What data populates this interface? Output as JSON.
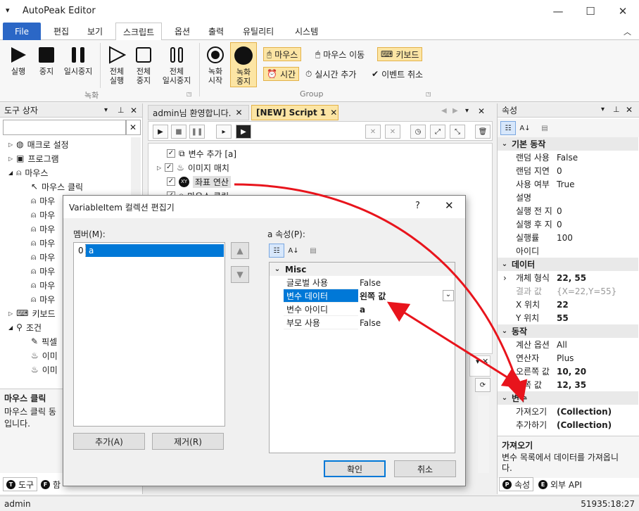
{
  "app": {
    "title": "AutoPeak Editor"
  },
  "menu": {
    "file": "File",
    "tabs": [
      "편집",
      "보기",
      "스크립트",
      "옵션",
      "출력",
      "유틸리티",
      "시스템"
    ]
  },
  "ribbon": {
    "buttons": [
      {
        "label": "실행",
        "icon": "play-icon"
      },
      {
        "label": "중지",
        "icon": "stop-icon"
      },
      {
        "label": "일시중지",
        "icon": "pause-icon"
      },
      {
        "label": "전체\n실행",
        "icon": "play-outline-icon"
      },
      {
        "label": "전체\n중지",
        "icon": "stop-outline-icon"
      },
      {
        "label": "전체\n일시중지",
        "icon": "pause-outline-icon"
      },
      {
        "label": "녹화\n시작",
        "icon": "record-start-icon"
      },
      {
        "label": "녹화\n중지",
        "icon": "record-stop-icon"
      }
    ],
    "group_record": "녹화",
    "group_group": "Group",
    "pills": {
      "mouse": "마우스",
      "mouse_move": "마우스 이동",
      "keyboard": "키보드",
      "time": "시간",
      "realtime_add": "실시간 추가",
      "event_cancel": "이벤트 취소"
    }
  },
  "toolbox": {
    "title": "도구 상자",
    "search_value": "",
    "items": [
      {
        "label": "매크로 설정",
        "icon": "globe-icon",
        "depth": 0
      },
      {
        "label": "프로그램",
        "icon": "program-icon",
        "depth": 0
      },
      {
        "label": "마우스",
        "icon": "mouse-icon",
        "depth": 0
      },
      {
        "label": "마우스 클릭",
        "icon": "mouse-click-icon",
        "depth": 1
      },
      {
        "label": "마우",
        "icon": "mouse-icon",
        "depth": 1
      },
      {
        "label": "마우",
        "icon": "mouse-icon",
        "depth": 1
      },
      {
        "label": "마우",
        "icon": "mouse-icon",
        "depth": 1
      },
      {
        "label": "마우",
        "icon": "mouse-icon",
        "depth": 1
      },
      {
        "label": "마우",
        "icon": "mouse-icon",
        "depth": 1
      },
      {
        "label": "마우",
        "icon": "mouse-icon",
        "depth": 1
      },
      {
        "label": "마우",
        "icon": "mouse-icon",
        "depth": 1
      },
      {
        "label": "마우",
        "icon": "mouse-icon",
        "depth": 1
      },
      {
        "label": "키보드",
        "icon": "keyboard-icon",
        "depth": 0
      },
      {
        "label": "조건",
        "icon": "condition-icon",
        "depth": 0
      },
      {
        "label": "픽셀",
        "icon": "pixel-icon",
        "depth": 1
      },
      {
        "label": "이미",
        "icon": "image-icon",
        "depth": 1
      },
      {
        "label": "이미",
        "icon": "image-icon",
        "depth": 1
      }
    ],
    "desc_title": "마우스 클릭",
    "desc_text": "마우스 클릭 동\n입니다.",
    "bottom_tabs": [
      "도구",
      "함"
    ]
  },
  "doc_tabs": [
    {
      "label": "admin님 환영합니다."
    },
    {
      "label": "[NEW] Script 1"
    }
  ],
  "script": {
    "lines": [
      {
        "label": "변수 추가 [a]",
        "icon": "variable-icon"
      },
      {
        "label": "이미지 매치",
        "icon": "image-match-icon"
      },
      {
        "label": "좌표 연산",
        "icon": "coordinate-icon"
      },
      {
        "label": "마우스 클릭",
        "icon": "mouse-icon"
      }
    ]
  },
  "dialog": {
    "title": "VariableItem 컬렉션 편집기",
    "help": "?",
    "members_label": "멤버(M):",
    "members": [
      {
        "index": "0",
        "name": "a"
      }
    ],
    "props_label": "a 속성(P):",
    "category": "Misc",
    "props": [
      {
        "key": "글로벌 사용",
        "value": "False"
      },
      {
        "key": "변수 데이터",
        "value": "왼쪽 값"
      },
      {
        "key": "변수 아이디",
        "value": "a"
      },
      {
        "key": "부모 사용",
        "value": "False"
      }
    ],
    "add": "추가(A)",
    "remove": "제거(R)",
    "ok": "확인",
    "cancel": "취소"
  },
  "props_panel": {
    "title": "속성",
    "cats": [
      {
        "name": "기본 동작",
        "rows": [
          [
            "랜덤 사용",
            "False"
          ],
          [
            "랜덤 지연",
            "0"
          ],
          [
            "사용 여부",
            "True"
          ],
          [
            "설명",
            ""
          ],
          [
            "실행 전 지",
            "0"
          ],
          [
            "실행 후 지",
            "0"
          ],
          [
            "실행률",
            "100"
          ],
          [
            "아이디",
            ""
          ]
        ]
      },
      {
        "name": "데이터",
        "rows": [
          [
            "개체 형식",
            "22, 55"
          ],
          [
            "결과 값",
            "{X=22,Y=55}"
          ],
          [
            "X 위치",
            "22"
          ],
          [
            "Y 위치",
            "55"
          ]
        ]
      },
      {
        "name": "동작",
        "rows": [
          [
            "계산 옵션",
            "All"
          ],
          [
            "연산자",
            "Plus"
          ],
          [
            "오른쪽 값",
            "10, 20"
          ],
          [
            "왼쪽 값",
            "12, 35"
          ]
        ]
      },
      {
        "name": "변수",
        "rows": [
          [
            "가져오기",
            "(Collection)"
          ],
          [
            "추가하기",
            "(Collection)"
          ]
        ]
      }
    ],
    "desc_title": "가져오기",
    "desc_text": "변수 목록에서 데이터를 가져옵니\n다.",
    "bottom_tabs": [
      "속성",
      "외부 API"
    ]
  },
  "status": {
    "user": "admin",
    "time": "51935:18:27"
  },
  "colors": {
    "accent": "#2b67c6",
    "highlight": "#fce5a4",
    "select": "#0078d7",
    "arrow": "#e8141c"
  }
}
